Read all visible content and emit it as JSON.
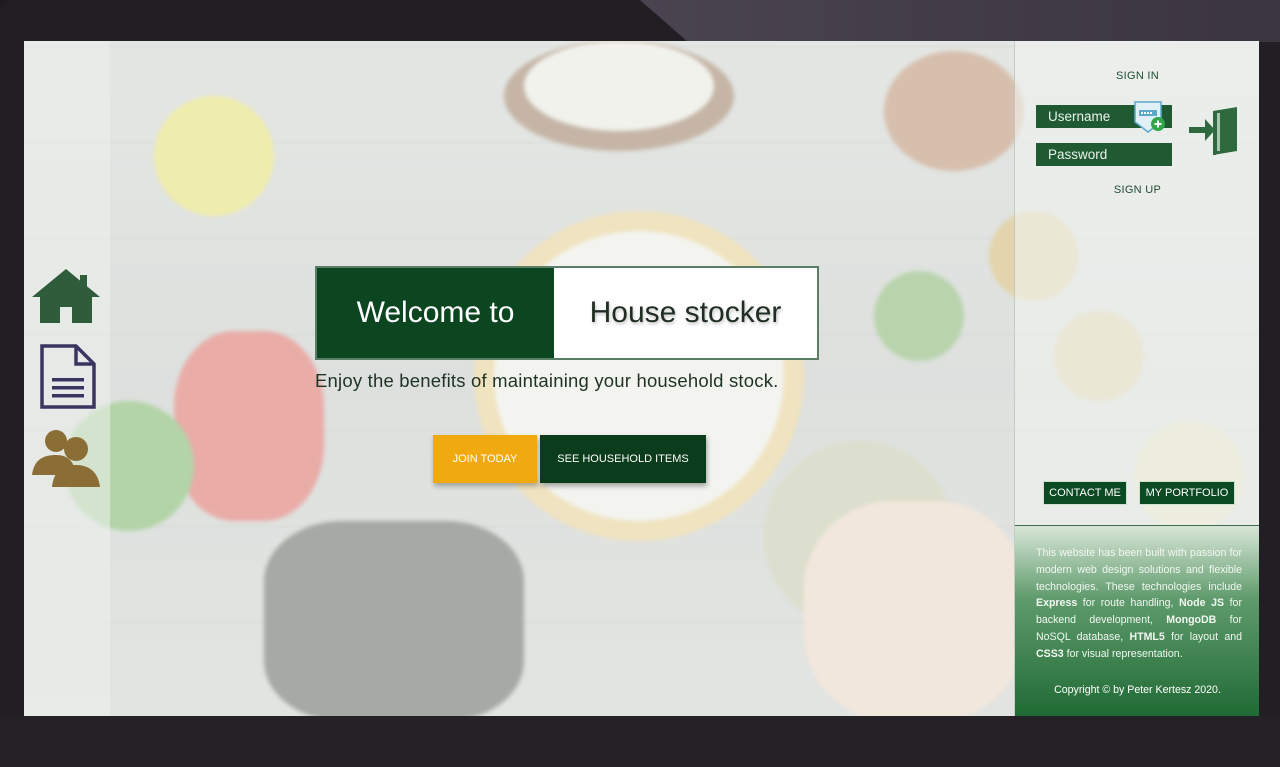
{
  "nav": {
    "items": [
      {
        "name": "home",
        "icon": "home-icon"
      },
      {
        "name": "document",
        "icon": "document-icon"
      },
      {
        "name": "users",
        "icon": "users-icon"
      }
    ]
  },
  "hero": {
    "title_left": "Welcome to",
    "title_right": "House stocker",
    "subtitle": "Enjoy the benefits of maintaining your household stock.",
    "join_label": "JOIN TODAY",
    "see_label": "SEE HOUSEHOLD ITEMS"
  },
  "auth": {
    "signin_label": "SIGN IN",
    "username_placeholder": "Username",
    "password_placeholder": "Password",
    "signup_label": "SIGN UP"
  },
  "links": {
    "contact_label": "CONTACT ME",
    "portfolio_label": "MY PORTFOLIO"
  },
  "footer": {
    "t1": "This website has been built with passion for modern web design solutions and flexible technologies. These technologies include ",
    "b1": "Express",
    "t2": " for route handling, ",
    "b2": "Node JS",
    "t3": " for backend development, ",
    "b3": "MongoDB",
    "t4": " for NoSQL database, ",
    "b4": "HTML5",
    "t5": " for layout and ",
    "b5": "CSS3",
    "t6": " for visual representation.",
    "copyright": "Copyright © by Peter Kertesz 2020."
  },
  "colors": {
    "primary_green": "#0b4620",
    "accent_yellow": "#f0aa10",
    "field_green": "#1f5a33"
  }
}
